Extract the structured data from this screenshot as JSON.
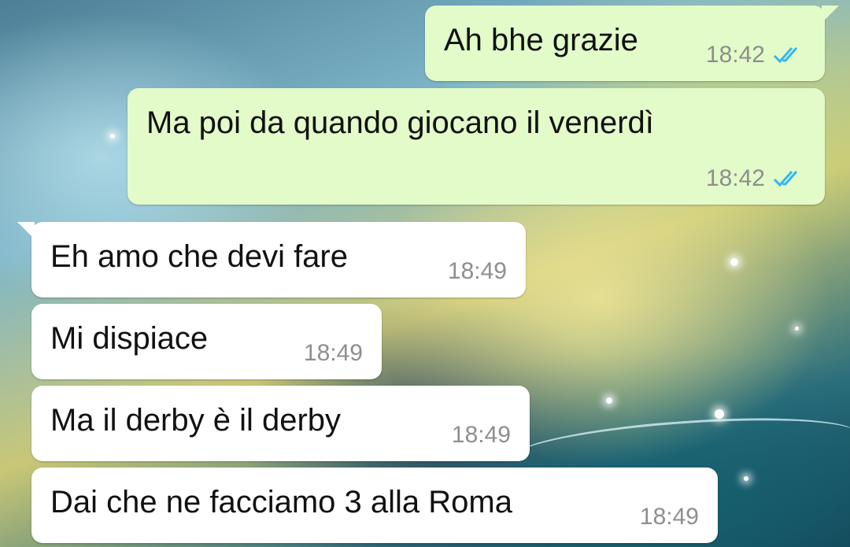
{
  "conversation": {
    "messages": [
      {
        "direction": "outgoing",
        "text": "Ah bhe grazie",
        "time": "18:42",
        "status_icon": "double-check-read-icon"
      },
      {
        "direction": "outgoing",
        "text": "Ma poi da quando giocano il venerdì",
        "time": "18:42",
        "status_icon": "double-check-read-icon"
      },
      {
        "direction": "incoming",
        "text": "Eh amo che devi fare",
        "time": "18:49"
      },
      {
        "direction": "incoming",
        "text": "Mi dispiace",
        "time": "18:49"
      },
      {
        "direction": "incoming",
        "text": "Ma il derby è il derby",
        "time": "18:49"
      },
      {
        "direction": "incoming",
        "text": "Dai che ne facciamo 3 alla Roma",
        "time": "18:49"
      }
    ]
  },
  "colors": {
    "outgoing_bubble": "#e2fbc8",
    "incoming_bubble": "#ffffff",
    "read_ticks": "#34b7f1",
    "timestamp": "#8e8e8e"
  }
}
